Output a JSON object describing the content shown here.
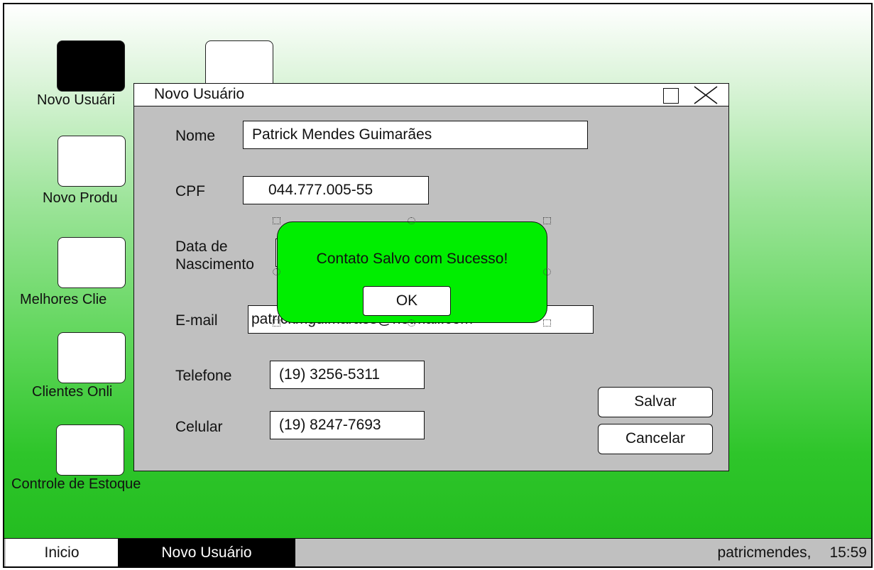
{
  "desktop": {
    "icons": [
      {
        "label": "Novo Usuári",
        "selected": true
      },
      {
        "label": "Novo Produ"
      },
      {
        "label": "Melhores Clie"
      },
      {
        "label": "Clientes Onli"
      },
      {
        "label": "Controle de Estoque"
      }
    ]
  },
  "window": {
    "title": "Novo Usuário",
    "fields": {
      "nome": {
        "label": "Nome",
        "value": "Patrick Mendes Guimarães"
      },
      "cpf": {
        "label": "CPF",
        "value": "044.777.005-55"
      },
      "nascimento": {
        "label_line1": "Data de",
        "label_line2": "Nascimento"
      },
      "email": {
        "label": "E-mail",
        "value": "patrickmguimaraes@hotmail.com"
      },
      "telefone": {
        "label": "Telefone",
        "value": "(19) 3256-5311"
      },
      "celular": {
        "label": "Celular",
        "value": "(19) 8247-7693"
      }
    },
    "save_label": "Salvar",
    "cancel_label": "Cancelar"
  },
  "popup": {
    "message": "Contato Salvo com Sucesso!",
    "ok_label": "OK",
    "background": "#00ee00"
  },
  "taskbar": {
    "start_label": "Inicio",
    "active_task": "Novo Usuário",
    "user": "patricmendes,",
    "time": "15:59"
  }
}
